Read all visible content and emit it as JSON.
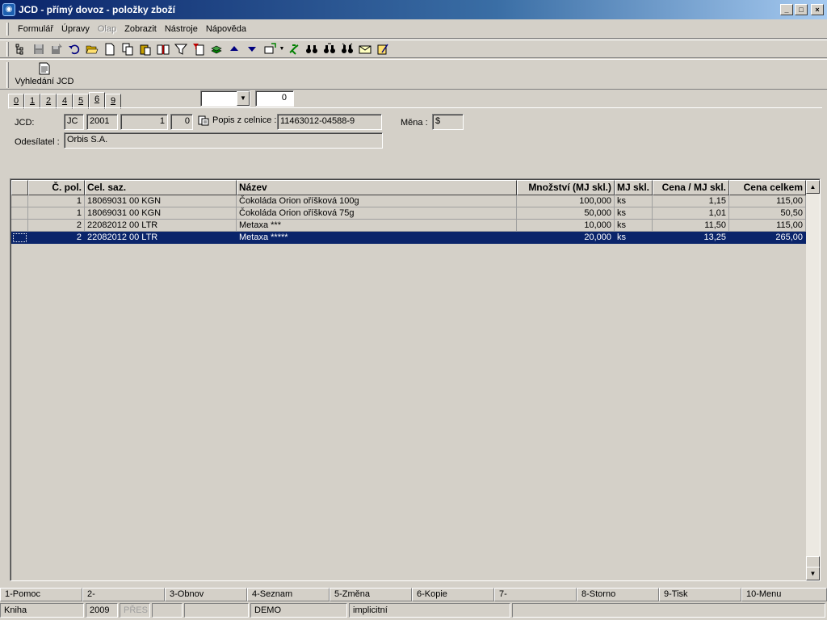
{
  "window": {
    "title": "JCD - přímý dovoz - položky zboží",
    "app_icon": "jcd-app-icon",
    "controls": {
      "minimize": "_",
      "maximize": "□",
      "close": "×"
    }
  },
  "menu": [
    {
      "label": "Formulář",
      "enabled": true
    },
    {
      "label": "Úpravy",
      "enabled": true
    },
    {
      "label": "Olap",
      "enabled": false
    },
    {
      "label": "Zobrazit",
      "enabled": true
    },
    {
      "label": "Nástroje",
      "enabled": true
    },
    {
      "label": "Nápověda",
      "enabled": true
    }
  ],
  "toolbar_icons": [
    "tree-view-icon",
    "save-icon",
    "save-as-icon",
    "undo-icon",
    "open-folder-icon",
    "new-document-icon",
    "copy-icon",
    "paste-icon",
    "book-icon",
    "filter-icon",
    "filter-document-icon",
    "stack-icon",
    "arrow-up-icon",
    "arrow-down-icon",
    "export-icon",
    "refresh-icon",
    "binoculars-icon",
    "binoculars-next-icon",
    "binoculars-prev-icon",
    "mail-icon",
    "notes-icon"
  ],
  "toolbar2": {
    "search_label": "Vyhledání JCD"
  },
  "tabs": [
    "0",
    "1",
    "2",
    "4",
    "5",
    "6",
    "9"
  ],
  "active_tab": "6",
  "combo": {
    "value": ""
  },
  "counter": {
    "value": "0"
  },
  "header": {
    "jcd_label": "JCD:",
    "jcd_type": "JC",
    "jcd_year": "2001",
    "jcd_number": "1",
    "jcd_sub": "0",
    "popis_label": "Popis z celnice :",
    "popis_value": "11463012-04588-9",
    "currency_label": "Měna :",
    "currency_value": "$",
    "sender_label": "Odesílatel :",
    "sender_value": "Orbis S.A."
  },
  "grid": {
    "columns": [
      "",
      "Č. pol.",
      "Cel. saz.",
      "Název",
      "Množství (MJ skl.)",
      "MJ skl.",
      "Cena / MJ skl.",
      "Cena celkem"
    ],
    "rows": [
      {
        "pol": "1",
        "saz": "18069031 00  KGN",
        "nazev": "Čokoláda Orion oříšková 100g",
        "mnozstvi": "100,000",
        "mj": "ks",
        "cena_mj": "1,15",
        "cena_celkem": "115,00",
        "selected": false
      },
      {
        "pol": "1",
        "saz": "18069031 00  KGN",
        "nazev": "Čokoláda Orion oříšková 75g",
        "mnozstvi": "50,000",
        "mj": "ks",
        "cena_mj": "1,01",
        "cena_celkem": "50,50",
        "selected": false
      },
      {
        "pol": "2",
        "saz": "22082012 00  LTR",
        "nazev": "Metaxa ***",
        "mnozstvi": "10,000",
        "mj": "ks",
        "cena_mj": "11,50",
        "cena_celkem": "115,00",
        "selected": false
      },
      {
        "pol": "2",
        "saz": "22082012 00  LTR",
        "nazev": "Metaxa *****",
        "mnozstvi": "20,000",
        "mj": "ks",
        "cena_mj": "13,25",
        "cena_celkem": "265,00",
        "selected": true
      }
    ]
  },
  "fkeys": [
    "1-Pomoc",
    "2-",
    "3-Obnov",
    "4-Seznam",
    "5-Změna",
    "6-Kopie",
    "7-",
    "8-Storno",
    "9-Tisk",
    "10-Menu"
  ],
  "status": [
    {
      "text": "Kniha",
      "disabled": false
    },
    {
      "text": "2009",
      "disabled": false
    },
    {
      "text": "PŘES",
      "disabled": true
    },
    {
      "text": "",
      "disabled": false
    },
    {
      "text": "",
      "disabled": false
    },
    {
      "text": "DEMO",
      "disabled": false
    },
    {
      "text": "implicitní",
      "disabled": false
    },
    {
      "text": "",
      "disabled": false
    }
  ]
}
